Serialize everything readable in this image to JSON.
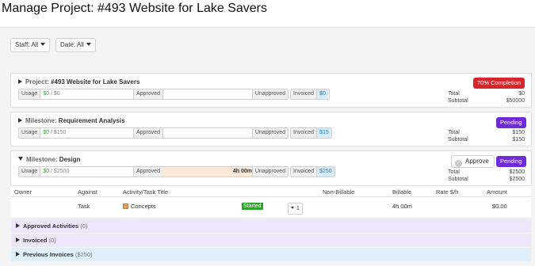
{
  "page": {
    "title": "Manage Project: #493 Website for Lake Savers"
  },
  "filters": {
    "staff": "Staff: All",
    "date": "Date: All"
  },
  "panels": {
    "project": {
      "kind": "Project:",
      "name": "#493 Website for Lake Savers",
      "usage_tag": "Usage",
      "usage_value": "$0",
      "usage_budget": "/ $0",
      "approved_tag": "Approved",
      "unapproved_tag": "Unapproved",
      "invoiced_tag": "Invoiced",
      "invoiced_value": "$0",
      "badge": "70% Completion",
      "total_label": "Total",
      "total_value": "$0",
      "subtotal_label": "Subtotal",
      "subtotal_value": "$50000"
    },
    "milestone1": {
      "kind": "Milestone:",
      "name": "Requirement Analysis",
      "usage_tag": "Usage",
      "usage_value": "$0",
      "usage_budget": "/ $150",
      "approved_tag": "Approved",
      "unapproved_tag": "Unapproved",
      "invoiced_tag": "Invoiced",
      "invoiced_value": "$15",
      "badge": "Pending",
      "total_label": "Total",
      "total_value": "$150",
      "subtotal_label": "Subtotal",
      "subtotal_value": "$150"
    },
    "milestone2": {
      "kind": "Milestone:",
      "name": "Design",
      "usage_tag": "Usage",
      "usage_value": "$0",
      "usage_budget": "/ $2500",
      "approved_tag": "Approved",
      "approved_hours": "4h 00m",
      "unapproved_tag": "Unapproved",
      "invoiced_tag": "Invoiced",
      "invoiced_value": "$250",
      "approve_label": "Approve",
      "badge": "Pending",
      "total_label": "Total",
      "total_value": "$2500",
      "subtotal_label": "Subtotal",
      "subtotal_value": "$2500"
    }
  },
  "table": {
    "columns": [
      "Owner",
      "Against",
      "Activity/Task Title",
      "Non-Billable",
      "Billable",
      "Rate $/h",
      "Amount"
    ],
    "rows": [
      {
        "owner": "",
        "against": "Task",
        "title": "Concepts",
        "status": "Started",
        "stepper": "1",
        "non_billable": "",
        "billable": "4h 00m",
        "rate": "",
        "amount": "$0.00"
      }
    ]
  },
  "accordions": [
    {
      "label": "Approved Activities",
      "count": "(0)"
    },
    {
      "label": "Invoiced",
      "count": "(0)"
    },
    {
      "label": "Previous Invoices",
      "count": "($250)"
    }
  ],
  "colors": {
    "red_badge": "#d7262b",
    "purple_badge": "#6f2bd8",
    "usage_green": "#3aa03a",
    "invoiced_blue": "#d6ecfa",
    "approved_orange": "#fde9d6",
    "lilac": "#ece5fb",
    "light_blue": "#dff0fb"
  },
  "icons": {
    "expand": "caret-right-icon",
    "collapse": "caret-down-icon",
    "task": "task-icon",
    "approve": "check-circle-icon"
  }
}
